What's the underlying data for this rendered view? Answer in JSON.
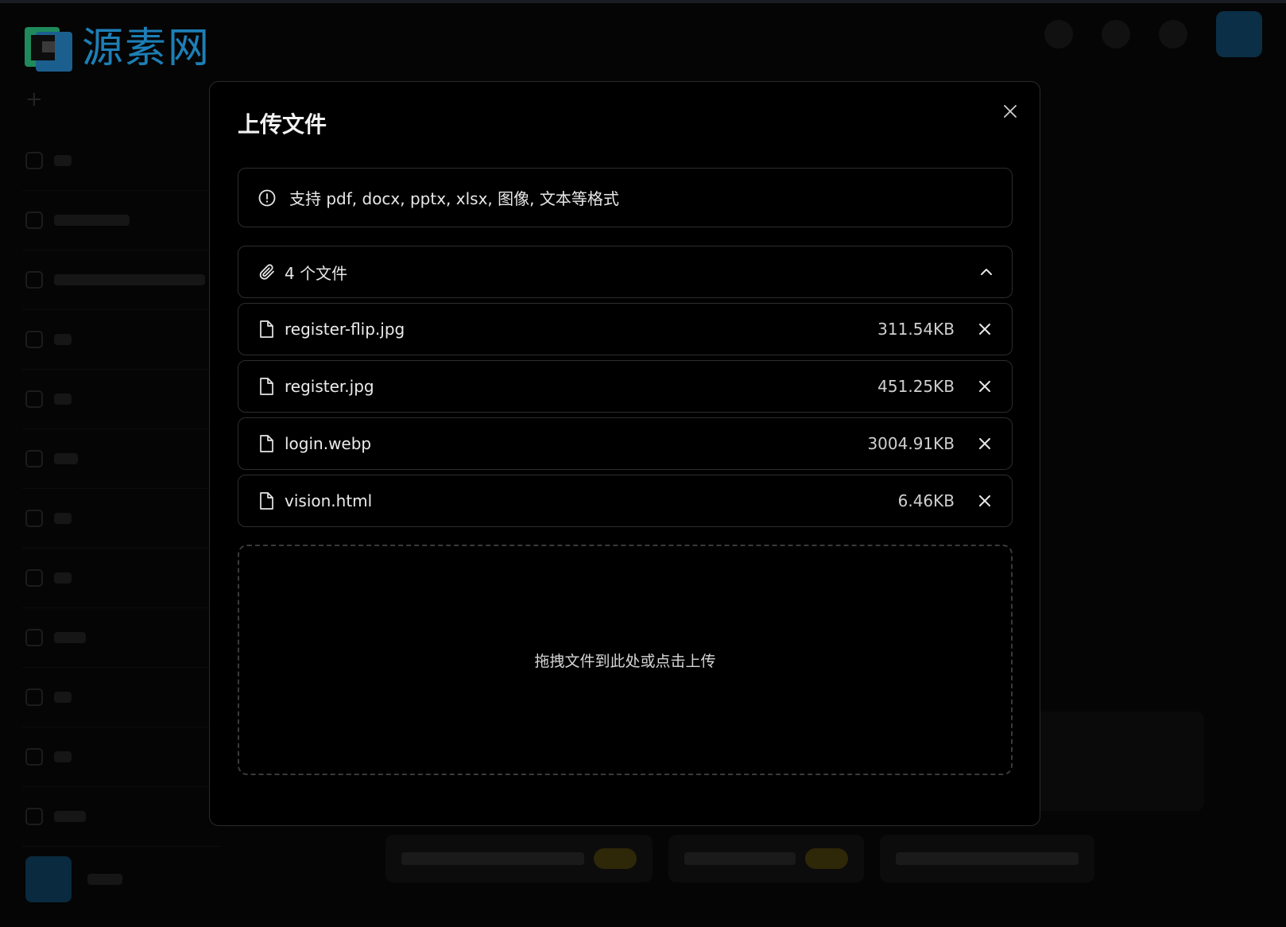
{
  "brand": {
    "logo_text": "源素网",
    "accent_color": "#1d7fb6"
  },
  "modal": {
    "title": "上传文件",
    "close_icon": "close-icon",
    "info": {
      "icon": "alert-circle-icon",
      "text": "支持 pdf, docx, pptx, xlsx, 图像, 文本等格式"
    },
    "files_header": {
      "icon": "paperclip-icon",
      "label": "4 个文件",
      "toggle_icon": "chevron-up-icon"
    },
    "files": [
      {
        "name": "register-flip.jpg",
        "size": "311.54KB"
      },
      {
        "name": "register.jpg",
        "size": "451.25KB"
      },
      {
        "name": "login.webp",
        "size": "3004.91KB"
      },
      {
        "name": "vision.html",
        "size": "6.46KB"
      }
    ],
    "dropzone": {
      "text": "拖拽文件到此处或点击上传"
    }
  }
}
